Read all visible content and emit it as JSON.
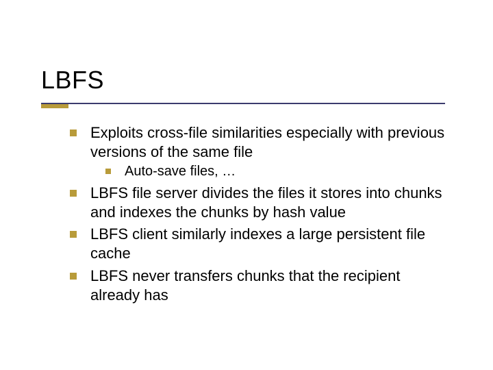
{
  "title": "LBFS",
  "bullets": [
    {
      "text": "Exploits cross-file similarities especially with previous versions of the same file",
      "children": [
        {
          "text": "Auto-save files, …"
        }
      ]
    },
    {
      "text": "LBFS file server  divides the files it stores into chunks and indexes the chunks by hash value"
    },
    {
      "text": "LBFS client similarly indexes a large persistent file cache"
    },
    {
      "text": "LBFS never transfers chunks that the recipient already has"
    }
  ]
}
